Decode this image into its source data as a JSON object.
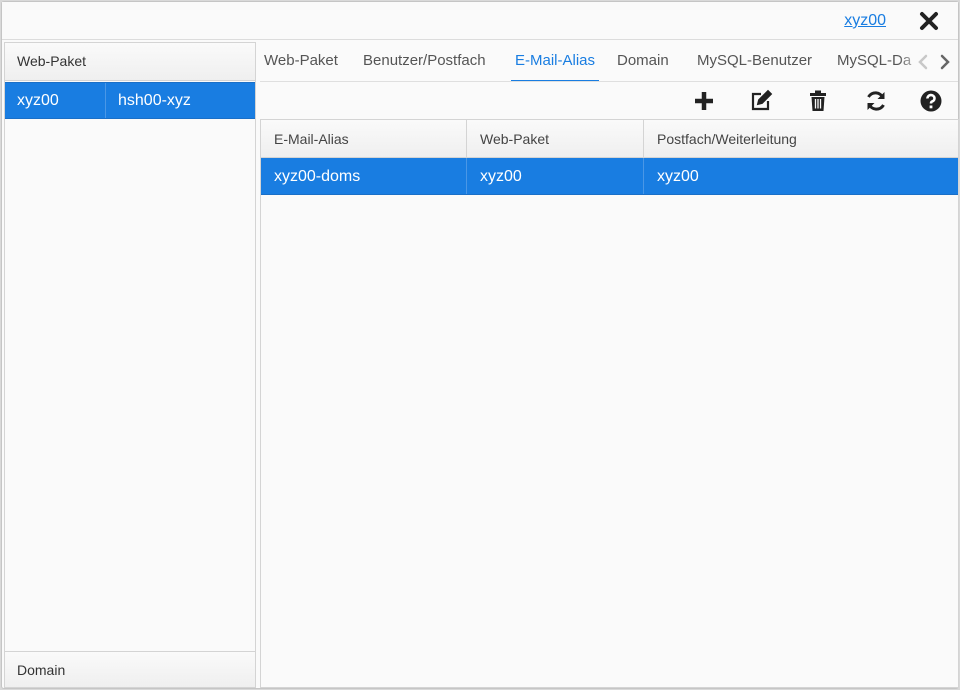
{
  "topbar": {
    "user": "xyz00"
  },
  "left_panel": {
    "title": "Web-Paket",
    "rows": [
      {
        "name": "xyz00",
        "value": "hsh00-xyz"
      }
    ],
    "footer": "Domain"
  },
  "tabs": [
    {
      "label": "Web-Paket",
      "active": false
    },
    {
      "label": "Benutzer/Postfach",
      "active": false
    },
    {
      "label": "E-Mail-Alias",
      "active": true
    },
    {
      "label": "Domain",
      "active": false
    },
    {
      "label": "MySQL-Benutzer",
      "active": false
    },
    {
      "label": "MySQL-Da",
      "active": false
    }
  ],
  "toolbar": {
    "icons": [
      "plus-icon",
      "edit-icon",
      "trash-icon",
      "refresh-icon",
      "help-icon"
    ]
  },
  "grid": {
    "columns": [
      "E-Mail-Alias",
      "Web-Paket",
      "Postfach/Weiterleitung"
    ],
    "rows": [
      [
        "xyz00-doms",
        "xyz00",
        "xyz00"
      ]
    ]
  },
  "colors": {
    "accent": "#197de1",
    "selected_row": "#197de1",
    "background": "#fafafa"
  }
}
